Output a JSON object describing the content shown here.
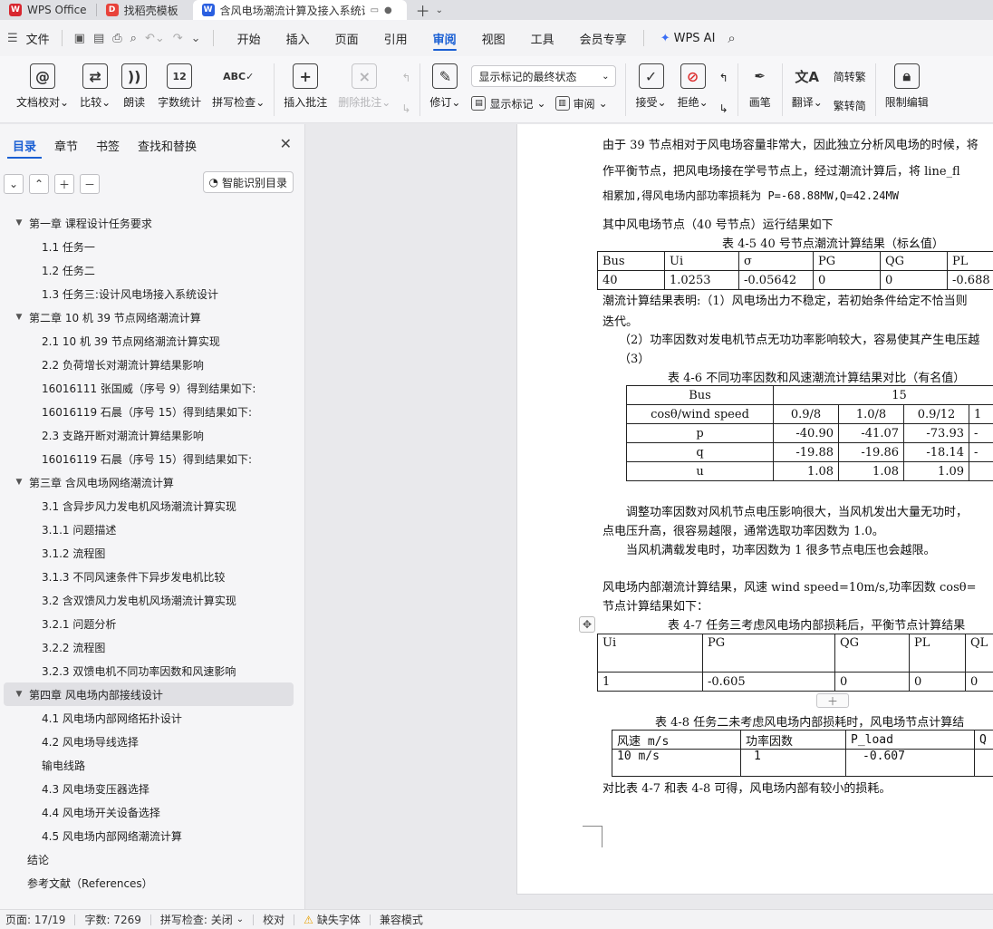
{
  "tabs": [
    {
      "label": "WPS Office",
      "icon": "wps-logo-icon",
      "color": "#d8262f"
    },
    {
      "label": "找稻壳模板",
      "icon": "docer-icon",
      "color": "#e8423a"
    },
    {
      "label": "含风电场潮流计算及接入系统设",
      "icon": "writer-icon",
      "color": "#2a5fe0",
      "active": true
    }
  ],
  "menu": {
    "file": "文件",
    "items": [
      "开始",
      "插入",
      "页面",
      "引用",
      "审阅",
      "视图",
      "工具",
      "会员专享"
    ],
    "active": "审阅",
    "ai": "WPS AI"
  },
  "ribbon": {
    "doc_check": "文档校对",
    "compare": "比较",
    "read_aloud": "朗读",
    "word_count": "字数统计",
    "spell_check": "拼写检查",
    "insert_comment": "插入批注",
    "delete_comment": "删除批注",
    "track_changes": "修订",
    "markup_select": "显示标记的最终状态",
    "show_markup": "显示标记",
    "review": "审阅",
    "accept": "接受",
    "reject": "拒绝",
    "pen": "画笔",
    "translate": "翻译",
    "to_traditional": "简转繁",
    "to_simplified": "繁转简",
    "restrict_edit": "限制编辑"
  },
  "left_panel": {
    "tabs": [
      "目录",
      "章节",
      "书签",
      "查找和替换"
    ],
    "active_tab": "目录",
    "ai_button": "智能识别目录",
    "toc": [
      {
        "text": "第一章  课程设计任务要求",
        "level": 1,
        "caret": true
      },
      {
        "text": "1.1  任务一",
        "level": 2
      },
      {
        "text": "1.2 任务二",
        "level": 2
      },
      {
        "text": "1.3 任务三:设计风电场接入系统设计",
        "level": 2
      },
      {
        "text": "第二章   10 机 39 节点网络潮流计算",
        "level": 1,
        "caret": true
      },
      {
        "text": "2.1   10 机 39 节点网络潮流计算实现",
        "level": 2
      },
      {
        "text": "2.2  负荷增长对潮流计算结果影响",
        "level": 2
      },
      {
        "text": "16016111 张国威（序号 9）得到结果如下:",
        "level": 2
      },
      {
        "text": "16016119 石晨（序号 15）得到结果如下:",
        "level": 2
      },
      {
        "text": "2.3  支路开断对潮流计算结果影响",
        "level": 2
      },
      {
        "text": "16016119 石晨（序号 15）得到结果如下:",
        "level": 2
      },
      {
        "text": "第三章   含风电场网络潮流计算",
        "level": 1,
        "caret": true
      },
      {
        "text": "3.1  含异步风力发电机风场潮流计算实现",
        "level": 2
      },
      {
        "text": "3.1.1 问题描述",
        "level": 2
      },
      {
        "text": "3.1.2  流程图",
        "level": 2
      },
      {
        "text": "3.1.3 不同风速条件下异步发电机比较",
        "level": 2
      },
      {
        "text": "3.2  含双馈风力发电机风场潮流计算实现",
        "level": 2
      },
      {
        "text": "3.2.1 问题分析",
        "level": 2
      },
      {
        "text": "3.2.2  流程图",
        "level": 2
      },
      {
        "text": "3.2.3  双馈电机不同功率因数和风速影响",
        "level": 2
      },
      {
        "text": "第四章   风电场内部接线设计",
        "level": 1,
        "caret": true,
        "selected": true
      },
      {
        "text": "4.1  风电场内部网络拓扑设计",
        "level": 2
      },
      {
        "text": "4.2  风电场导线选择",
        "level": 2
      },
      {
        "text": "输电线路",
        "level": 2
      },
      {
        "text": "4.3  风电场变压器选择",
        "level": 2
      },
      {
        "text": "4.4  风电场开关设备选择",
        "level": 2
      },
      {
        "text": "4.5  风电场内部网络潮流计算",
        "level": 2
      },
      {
        "text": "结论",
        "level": 1
      },
      {
        "text": "参考文献（References）",
        "level": 1
      }
    ]
  },
  "doc": {
    "para1": "由于 39 节点相对于风电场容量非常大，因此独立分析风电场的时候，将",
    "para2": "作平衡节点，把风电场接在学号节点上，经过潮流计算后，将 line_fl",
    "para3": "相累加,得风电场内部功率损耗为 P=-68.88MW,Q=42.24MW",
    "para4": "其中风电场节点（40 号节点）运行结果如下",
    "cap45": "表 4-5   40 号节点潮流计算结果（标幺值）",
    "t45": {
      "headers": [
        "Bus",
        "Ui",
        "σ",
        "PG",
        "QG",
        "PL"
      ],
      "row": [
        "40",
        "1.0253",
        "-0.05642",
        "0",
        "0",
        "-0.688"
      ]
    },
    "res1": "潮流计算结果表明:（1）风电场出力不稳定，若初始条件给定不恰当则",
    "res1b": "迭代。",
    "res2": "（2）功率因数对发电机节点无功功率影响较大，容易使其产生电压越",
    "res3": "（3）",
    "cap46": "表 4-6   不同功率因数和风速潮流计算结果对比（有名值）",
    "t46": {
      "bus_label": "Bus",
      "bus_value": "15",
      "rows": [
        {
          "label": "cosθ/wind speed",
          "values": [
            "0.9/8",
            "1.0/8",
            "0.9/12",
            "1"
          ]
        },
        {
          "label": "p",
          "values": [
            "-40.90",
            "-41.07",
            "-73.93",
            "-"
          ]
        },
        {
          "label": "q",
          "values": [
            "-19.88",
            "-19.86",
            "-18.14",
            "-"
          ]
        },
        {
          "label": "u",
          "values": [
            "1.08",
            "1.08",
            "1.09",
            ""
          ]
        }
      ]
    },
    "para5": "调整功率因数对风机节点电压影响很大，当风机发出大量无功时，",
    "para5b": "点电压升高，很容易越限，通常选取功率因数为 1.0。",
    "para6": "当风机满载发电时，功率因数为 1 很多节点电压也会越限。",
    "para7": "风电场内部潮流计算结果，风速 wind speed=10m/s,功率因数 cosθ=",
    "para7b": "节点计算结果如下：",
    "cap47": "表 4-7   任务三考虑风电场内部损耗后，平衡节点计算结果",
    "t47": {
      "headers": [
        "Ui",
        "PG",
        "QG",
        "PL",
        "QL"
      ],
      "row": [
        "1",
        "-0.605",
        "0",
        "0",
        "0"
      ]
    },
    "cap48": "表 4-8   任务二未考虑风电场内部损耗时，风电场节点计算结",
    "t48": {
      "headers": [
        "风速 m/s",
        "功率因数",
        "P_load",
        "Q"
      ],
      "row": [
        "10  m/s",
        "1",
        "-0.607",
        ""
      ]
    },
    "para8": "对比表 4-7 和表 4-8 可得，风电场内部有较小的损耗。"
  },
  "status": {
    "page": "页面: 17/19",
    "words": "字数: 7269",
    "spell": "拼写检查: 关闭",
    "proof": "校对",
    "missing_font": "缺失字体",
    "compat": "兼容模式"
  }
}
